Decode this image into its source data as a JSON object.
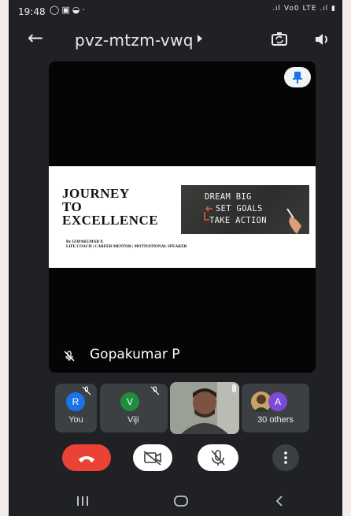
{
  "status_bar": {
    "time": "19:48",
    "left_icons": [
      "whatsapp-icon",
      "gallery-icon",
      "bag-icon",
      "dot-icon"
    ],
    "right_icons": [
      "signal-icon",
      "volte-lte-icon",
      "signal-icon",
      "battery-icon"
    ],
    "network_label": "Vo0 LTE"
  },
  "toolbar": {
    "meeting_code": "pvz-mtzm-vwq",
    "icons": [
      "back-arrow-icon",
      "switch-camera-icon",
      "speaker-icon"
    ]
  },
  "main_tile": {
    "slide": {
      "title": "JOURNEY\nTO\nEXCELLENCE",
      "byline": "By GOPAKUMAR P,\nLIFE COACH | CAREER MENTOR | MOTIVATIONAL SPEAKER",
      "image_lines": [
        "DREAM BIG",
        "SET GOALS",
        "TAKE ACTION"
      ]
    },
    "speaker_name": "Gopakumar P",
    "pin_icon": "pin-icon",
    "muted_icon": "mic-off-icon"
  },
  "participants": [
    {
      "initial": "R",
      "label": "You",
      "color": "#1a73e8",
      "muted": true
    },
    {
      "initial": "V",
      "label": "Viji",
      "color": "#1e8e3e",
      "muted": true
    },
    {
      "label": "",
      "type": "video"
    },
    {
      "initial": "A",
      "label": "30 others",
      "color": "#7b4bd6"
    }
  ],
  "controls": [
    {
      "name": "end-call",
      "icon": "phone-hangup-icon",
      "color": "#ea4335"
    },
    {
      "name": "camera-off",
      "icon": "video-off-icon",
      "color": "#ffffff"
    },
    {
      "name": "mic-off",
      "icon": "mic-off-icon",
      "color": "#ffffff"
    },
    {
      "name": "more-options",
      "icon": "more-vertical-icon",
      "color": "#3c4043"
    }
  ],
  "navbar": {
    "buttons": [
      "recents-icon",
      "home-icon",
      "back-icon"
    ]
  },
  "colors": {
    "background": "#202124",
    "tile": "#3c4043",
    "end_call": "#ea4335"
  }
}
